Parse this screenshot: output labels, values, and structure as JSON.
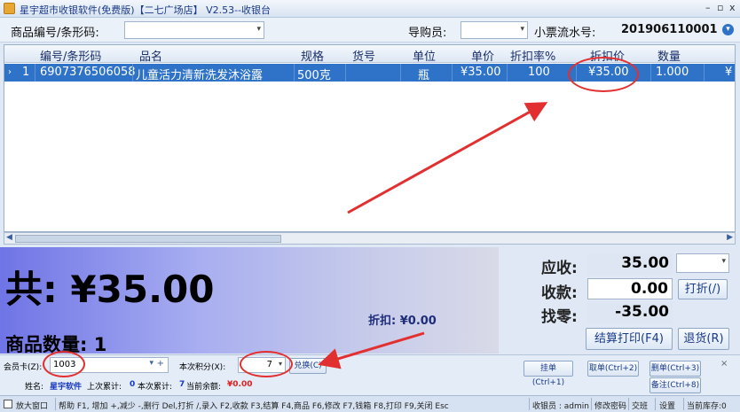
{
  "window": {
    "title": "星宇超市收银软件(免费版)【二七广场店】 V2.53--收银台",
    "controls": [
      "–",
      "▫",
      "x"
    ]
  },
  "toolbar": {
    "product_label": "商品编号/条形码:",
    "product_value": "",
    "guide_label": "导购员:",
    "guide_value": "",
    "ticket_label": "小票流水号:",
    "ticket_value": "201906110001"
  },
  "grid": {
    "columns": [
      "编号/条形码",
      "品名",
      "规格",
      "货号",
      "单位",
      "单价",
      "折扣率%",
      "折扣价",
      "数量"
    ],
    "rows": [
      {
        "index": "1",
        "code": "6907376506058",
        "name": "儿童活力清新洗发沐浴露",
        "spec": "500克",
        "sku": "",
        "unit": "瓶",
        "price": "¥35.00",
        "rate": "100",
        "disc_price": "¥35.00",
        "qty": "1.000",
        "extra": "¥"
      }
    ]
  },
  "summary": {
    "total": "共: ¥35.00",
    "discount": "折扣: ¥0.00",
    "item_count": "商品数量: 1"
  },
  "payment": {
    "due_label": "应收:",
    "due_value": "35.00",
    "paid_label": "收款:",
    "paid_value": "0.00",
    "change_label": "找零:",
    "change_value": "-35.00",
    "discount_btn": "打折(/)",
    "settle_btn": "结算打印(F4)",
    "return_btn": "退货(R)"
  },
  "member": {
    "card_label": "会员卡(Z):",
    "card_value": "1003",
    "points_label": "本次积分(X):",
    "points_value": "7",
    "redeem_btn": "兑换(C)",
    "name_label": "姓名:",
    "name_value": "星宇软件",
    "prev_label": "上次累计:",
    "prev_value": "0",
    "this_label": "本次累计:",
    "this_value": "7",
    "balance_label": "当前余额:",
    "balance_value": "¥0.00",
    "hang_btn": "挂单(Ctrl+1)",
    "take_btn": "取单(Ctrl+2)",
    "delete_btn": "删单(Ctrl+3)",
    "note_btn": "备注(Ctrl+8)"
  },
  "status": {
    "enlarge": "放大窗口",
    "help": "帮助 F1, 增加 +,减少 -,删行 Del,打折 /,录入 F2,收款 F3,结算 F4,商品 F6,修改 F7,钱箱 F8,打印 F9,关闭 Esc",
    "cashier": "收银员 : admin",
    "change_pwd": "修改密码",
    "shift": "交班",
    "settings": "设置",
    "stock": "当前库存:0"
  },
  "colors": {
    "selected_row": "#2f73c9",
    "annotation": "#e23030",
    "balance": "#e02020"
  }
}
